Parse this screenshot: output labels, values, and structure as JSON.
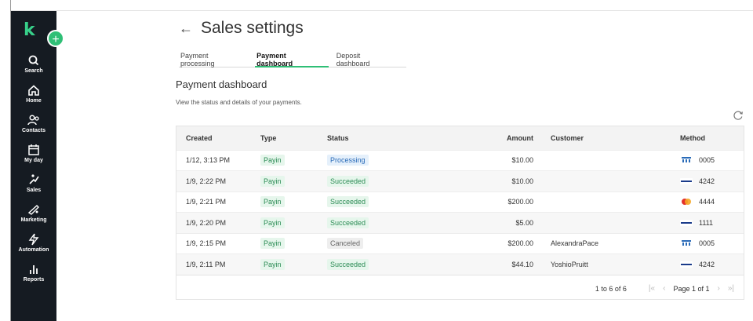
{
  "sidebar": {
    "logo": "k",
    "add_symbol": "+",
    "items": [
      {
        "label": "Search",
        "icon": "search-icon"
      },
      {
        "label": "Home",
        "icon": "home-icon"
      },
      {
        "label": "Contacts",
        "icon": "contacts-icon"
      },
      {
        "label": "My day",
        "icon": "calendar-icon"
      },
      {
        "label": "Sales",
        "icon": "sales-icon"
      },
      {
        "label": "Marketing",
        "icon": "marketing-icon"
      },
      {
        "label": "Automation",
        "icon": "lightning-icon"
      },
      {
        "label": "Reports",
        "icon": "reports-icon"
      }
    ]
  },
  "header": {
    "back_symbol": "←",
    "title": "Sales settings"
  },
  "tabs": [
    {
      "label": "Payment processing",
      "active": false
    },
    {
      "label": "Payment dashboard",
      "active": true
    },
    {
      "label": "Deposit dashboard",
      "active": false
    }
  ],
  "section": {
    "title": "Payment dashboard",
    "description": "View the status and details of your payments."
  },
  "table": {
    "columns": {
      "created": "Created",
      "type": "Type",
      "status": "Status",
      "amount": "Amount",
      "customer": "Customer",
      "method": "Method"
    },
    "rows": [
      {
        "created": "1/12, 3:13 PM",
        "type": "Payin",
        "status": "Processing",
        "status_kind": "processing",
        "amount": "$10.00",
        "customer": "",
        "method_icon": "bank-icon",
        "method_last4": "0005"
      },
      {
        "created": "1/9, 2:22 PM",
        "type": "Payin",
        "status": "Succeeded",
        "status_kind": "succeeded",
        "amount": "$10.00",
        "customer": "",
        "method_icon": "visa-icon",
        "method_last4": "4242"
      },
      {
        "created": "1/9, 2:21 PM",
        "type": "Payin",
        "status": "Succeeded",
        "status_kind": "succeeded",
        "amount": "$200.00",
        "customer": "",
        "method_icon": "mastercard-icon",
        "method_last4": "4444"
      },
      {
        "created": "1/9, 2:20 PM",
        "type": "Payin",
        "status": "Succeeded",
        "status_kind": "succeeded",
        "amount": "$5.00",
        "customer": "",
        "method_icon": "visa-icon",
        "method_last4": "1111"
      },
      {
        "created": "1/9, 2:15 PM",
        "type": "Payin",
        "status": "Canceled",
        "status_kind": "canceled",
        "amount": "$200.00",
        "customer": "AlexandraPace",
        "method_icon": "bank-icon",
        "method_last4": "0005"
      },
      {
        "created": "1/9, 2:11 PM",
        "type": "Payin",
        "status": "Succeeded",
        "status_kind": "succeeded",
        "amount": "$44.10",
        "customer": "YoshioPruitt",
        "method_icon": "visa-icon",
        "method_last4": "4242"
      }
    ]
  },
  "pagination": {
    "range": "1 to 6 of 6",
    "first": "|«",
    "prev": "‹",
    "page": "Page 1 of 1",
    "next": "›",
    "last": "»|"
  },
  "colors": {
    "sidebar_bg": "#151b22",
    "accent": "#2fbf76",
    "processing": "#2a6bb8"
  }
}
